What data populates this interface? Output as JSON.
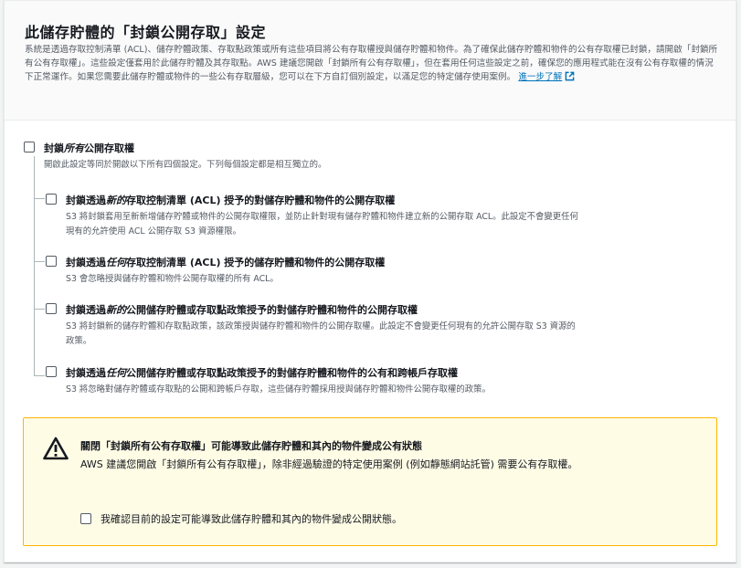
{
  "header": {
    "title": "此儲存貯體的「封鎖公開存取」設定",
    "description": "系統是透過存取控制清單 (ACL)、儲存貯體政策、存取點政策或所有這些項目將公有存取權授與儲存貯體和物件。為了確保此儲存貯體和物件的公有存取權已封鎖，請開啟「封鎖所有公有存取權」。這些設定僅套用於此儲存貯體及其存取點。AWS 建議您開啟「封鎖所有公有存取權」，但在套用任何這些設定之前，確保您的應用程式能在沒有公有存取權的情況下正常運作。如果您需要此儲存貯體或物件的一些公有存取層級，您可以在下方自訂個別設定，以滿足您的特定儲存使用案例。",
    "learn_more": "進一步了解"
  },
  "block_all": {
    "label_pre": "封鎖",
    "label_em": "所有",
    "label_post": "公開存取權",
    "description": "開啟此設定等同於開啟以下所有四個設定。下列每個設定都是相互獨立的。"
  },
  "settings": [
    {
      "label_pre": "封鎖透過",
      "label_em": "新的",
      "label_post": "存取控制清單 (ACL) 授予的對儲存貯體和物件的公開存取權",
      "description_1": "S3 將封鎖套用至新新增儲存貯體或物件的公開存取權限，並防止針對現有儲存貯體和物件建立新的公開存取 ACL。此設定不會變更任何",
      "description_2": "現有的允許使用 ACL 公開存取 S3 資源權限。"
    },
    {
      "label_pre": "封鎖透過",
      "label_em": "任何",
      "label_post": "存取控制清單 (ACL) 授予的儲存貯體和物件的公開存取權",
      "description_1": "S3 會忽略授與儲存貯體和物件公開存取權的所有 ACL。",
      "description_2": ""
    },
    {
      "label_pre": "封鎖透過",
      "label_em": "新的",
      "label_post": "公開儲存貯體或存取點政策授予的對儲存貯體和物件的公開存取權",
      "description_1": "S3 將封鎖新的儲存貯體和存取點政策，該政策授與儲存貯體和物件的公開存取權。此設定不會變更任何現有的允許公開存取 S3 資源的",
      "description_2": "政策。"
    },
    {
      "label_pre": "封鎖透過",
      "label_em": "任何",
      "label_post": "公開儲存貯體或存取點政策授予的對儲存貯體和物件的公有和跨帳戶存取權",
      "description_1": "S3 將忽略對儲存貯體或存取點的公開和跨帳戶存取，這些儲存貯體採用授與儲存貯體和物件公開存取權的政策。",
      "description_2": ""
    }
  ],
  "warning": {
    "title": "關閉「封鎖所有公有存取權」可能導致此儲存貯體和其內的物件變成公有狀態",
    "body": "AWS 建議您開啟「封鎖所有公有存取權」，除非經過驗證的特定使用案例 (例如靜態網站託管) 需要公有存取權。",
    "ack_label": "我確認目前的設定可能導致此儲存貯體和其內的物件變成公開狀態。"
  },
  "colors": {
    "link": "#0073bb",
    "warning_border": "#ffb700",
    "warning_bg": "#fffce6"
  }
}
